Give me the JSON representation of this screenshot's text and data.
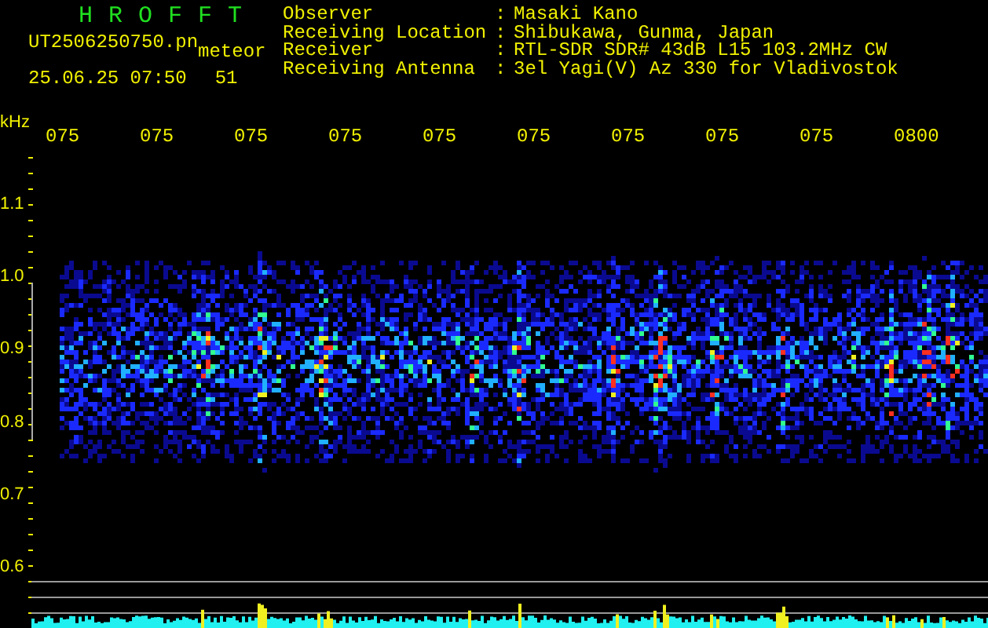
{
  "app": {
    "title": "HROFFT"
  },
  "file": {
    "name": "UT2506250750.pn",
    "tag": "meteor",
    "datetime": "25.06.25 07:50",
    "count": "51"
  },
  "station": [
    {
      "label": "Observer",
      "separator": ":",
      "value": "Masaki Kano"
    },
    {
      "label": "Receiving Location",
      "separator": ":",
      "value": "Shibukawa, Gunma, Japan"
    },
    {
      "label": "Receiver",
      "separator": ":",
      "value": "RTL-SDR SDR# 43dB L15 103.2MHz CW"
    },
    {
      "label": "Receiving Antenna",
      "separator": ":",
      "value": "3el Yagi(V) Az 330 for Vladivostok"
    }
  ],
  "spectrogram": {
    "unit": "kHz",
    "time_labels": [
      "075",
      "075",
      "075",
      "075",
      "075",
      "075",
      "075",
      "075",
      "075",
      "0800"
    ],
    "freq_labels": [
      "1.1",
      "1.0",
      "0.9",
      "0.8",
      "0.7",
      "0.6"
    ]
  }
}
